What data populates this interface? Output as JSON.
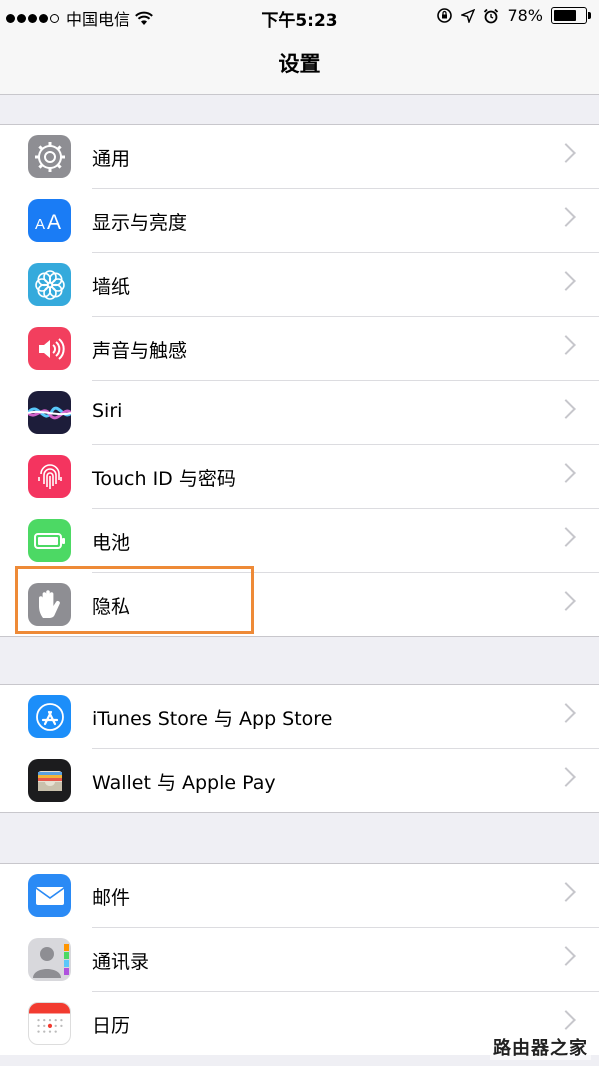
{
  "status_bar": {
    "carrier": "中国电信",
    "time": "下午5:23",
    "battery_percent": "78%",
    "battery_level": 0.78,
    "signal_dots_filled": 4,
    "signal_dots_total": 5
  },
  "nav": {
    "title": "设置"
  },
  "groups": [
    {
      "items": [
        {
          "label": "通用",
          "icon": "gear-icon",
          "color": "#8e8e93"
        },
        {
          "label": "显示与亮度",
          "icon": "text-size-icon",
          "color": "#1a7cf5"
        },
        {
          "label": "墙纸",
          "icon": "flower-icon",
          "color": "#35aadc"
        },
        {
          "label": "声音与触感",
          "icon": "speaker-icon",
          "color": "#f23f5e"
        },
        {
          "label": "Siri",
          "icon": "siri-icon",
          "color": "#1d1d3a"
        },
        {
          "label": "Touch ID 与密码",
          "icon": "fingerprint-icon",
          "color": "#f4345f"
        },
        {
          "label": "电池",
          "icon": "battery-icon",
          "color": "#4cd964"
        },
        {
          "label": "隐私",
          "icon": "hand-icon",
          "color": "#8e8e93"
        }
      ]
    },
    {
      "items": [
        {
          "label": "iTunes Store 与 App Store",
          "icon": "app-store-icon",
          "color": "#1c8ef9"
        },
        {
          "label": "Wallet 与 Apple Pay",
          "icon": "wallet-icon",
          "color": "#1c1c1e"
        }
      ]
    },
    {
      "items": [
        {
          "label": "邮件",
          "icon": "mail-icon",
          "color": "#2a8af5"
        },
        {
          "label": "通讯录",
          "icon": "contacts-icon",
          "color": "#a8a8ad"
        },
        {
          "label": "日历",
          "icon": "calendar-icon",
          "color": "#ffffff"
        }
      ]
    }
  ],
  "highlight_color": "#ee8a37",
  "watermark": "路由器之家"
}
